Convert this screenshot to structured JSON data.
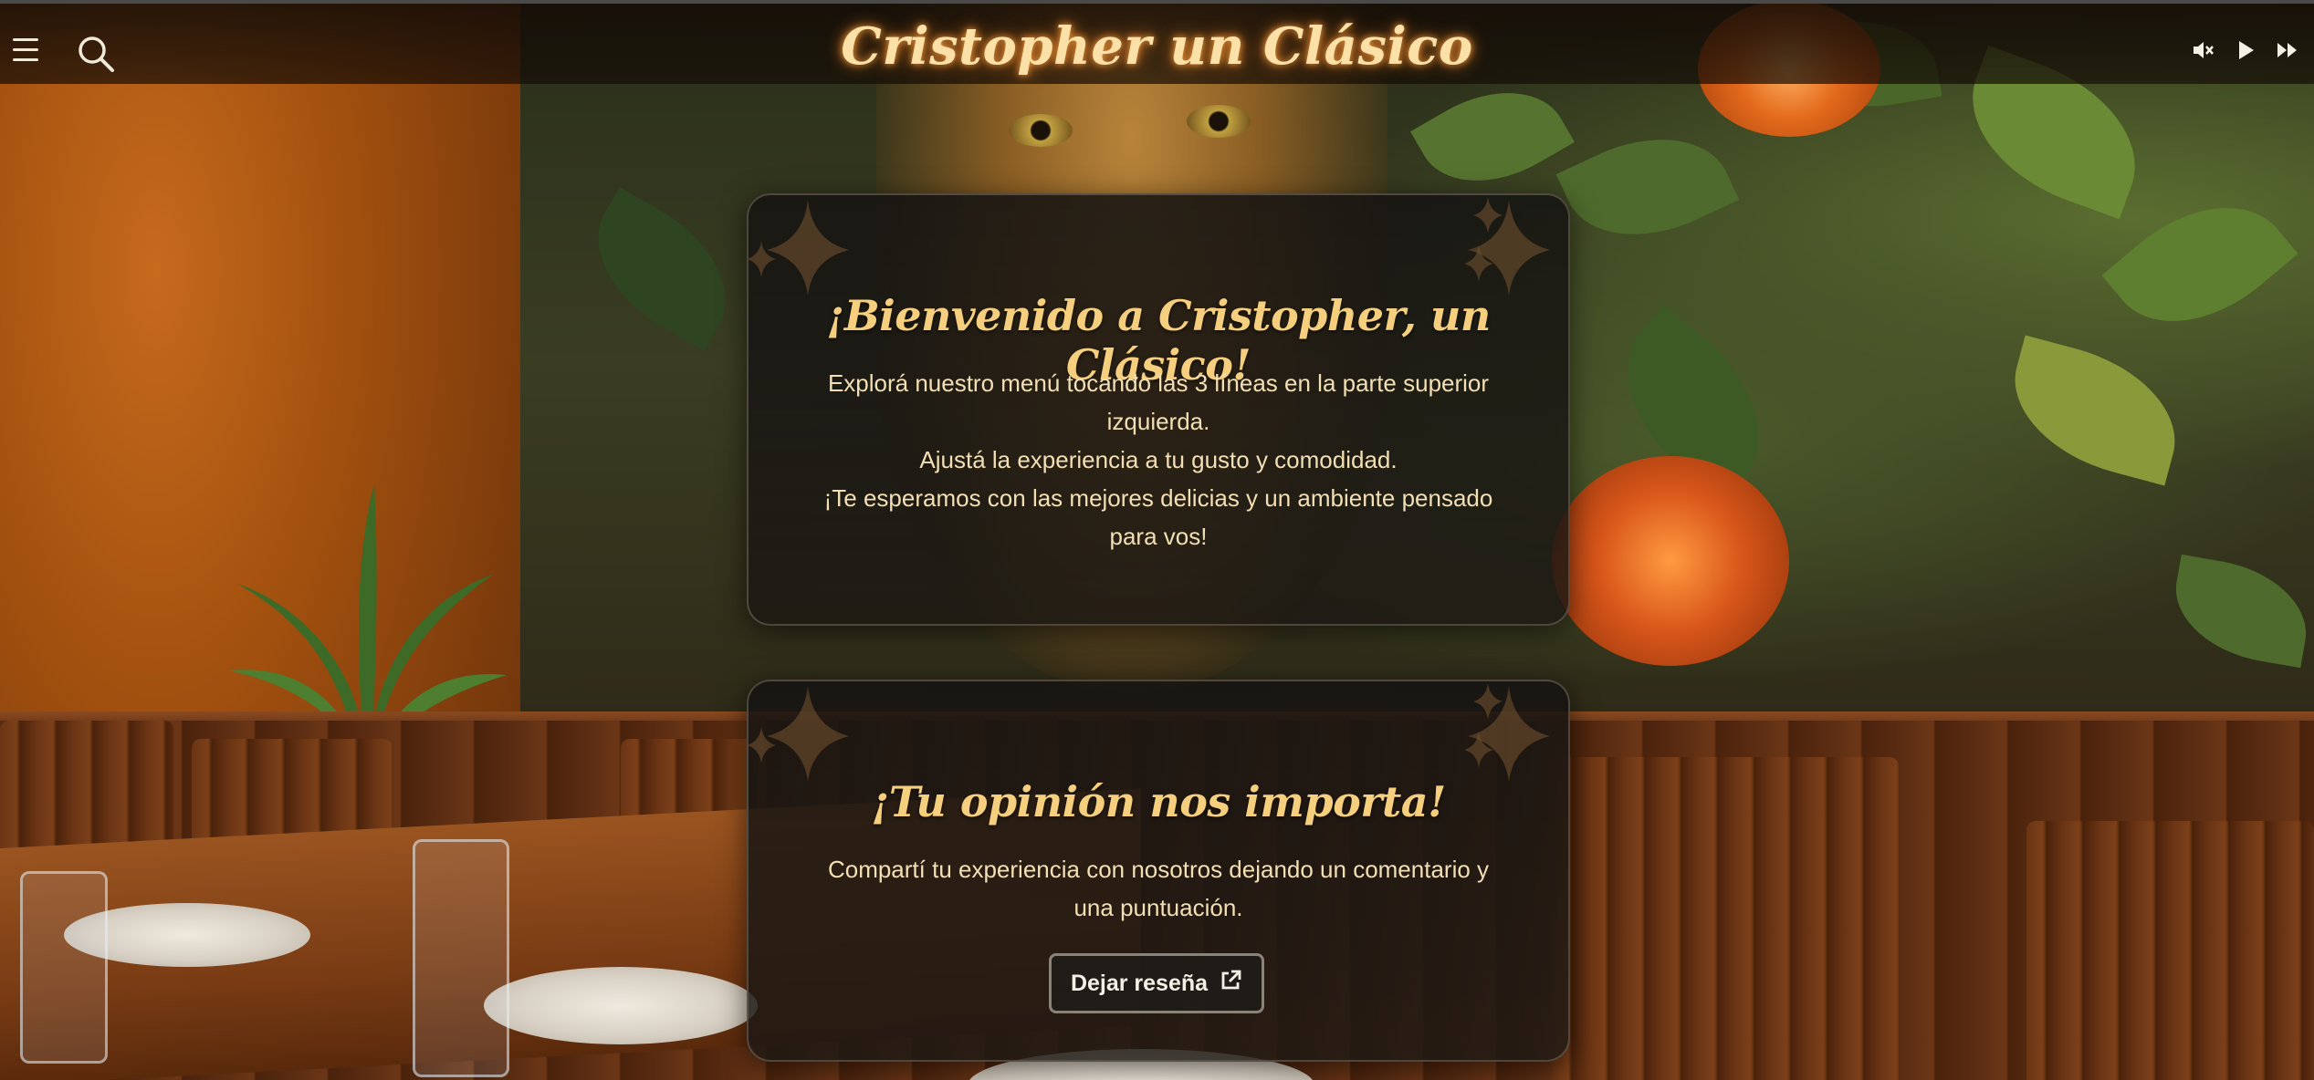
{
  "header": {
    "title": "Cristopher un Clásico",
    "menu_icon": "hamburger-menu-icon",
    "search_icon": "search-icon",
    "player": {
      "mute_icon": "mute-icon",
      "play_icon": "play-icon",
      "next_icon": "fast-forward-icon"
    }
  },
  "welcome_card": {
    "heading": "¡Bienvenido a Cristopher, un Clásico!",
    "line1": "Explorá nuestro menú tocando las 3 líneas en la parte superior izquierda.",
    "line2": "Ajustá la experiencia a tu gusto y comodidad.",
    "line3": "¡Te esperamos con las mejores delicias y un ambiente pensado para vos!"
  },
  "review_card": {
    "heading": "¡Tu opinión nos importa!",
    "text": "Compartí tu experiencia con nosotros dejando un comentario y una puntuación.",
    "button_label": "Dejar reseña",
    "button_icon": "external-link-icon"
  },
  "colors": {
    "title_glow": "#f19a3c",
    "title_text": "#fbe0a8",
    "heading_gold": "#f5cf7e",
    "body_text": "#f3dfb4"
  }
}
